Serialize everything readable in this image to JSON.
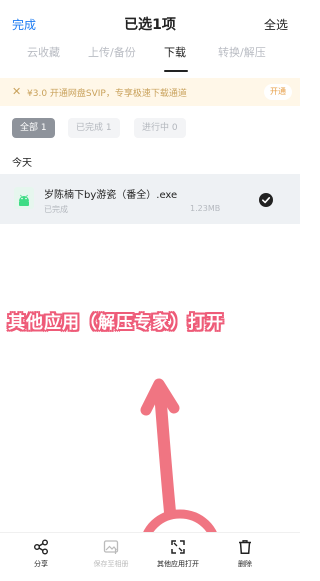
{
  "header": {
    "done_label": "完成",
    "title": "已选1项",
    "select_all_label": "全选"
  },
  "tabs": [
    {
      "label": "云收藏",
      "active": false
    },
    {
      "label": "上传/备份",
      "active": false
    },
    {
      "label": "下载",
      "active": true
    },
    {
      "label": "转换/解压",
      "active": false
    }
  ],
  "banner": {
    "text": "¥3.0 开通网盘SVIP，专享极速下载通道",
    "button_label": "开通"
  },
  "filters": [
    {
      "label": "全部 1",
      "active": true
    },
    {
      "label": "已完成 1",
      "active": false
    },
    {
      "label": "进行中 0",
      "active": false
    }
  ],
  "section_title": "今天",
  "file": {
    "name": "岁陈楠下by游瓷（番全）.exe",
    "status": "已完成",
    "size": "1.23MB",
    "selected": true
  },
  "annotation": {
    "text": "其他应用（解压专家）打开",
    "color": "#ee5b78"
  },
  "toolbar": [
    {
      "label": "分享",
      "icon": "share-icon",
      "enabled": true
    },
    {
      "label": "保存至相册",
      "icon": "save-album-icon",
      "enabled": false
    },
    {
      "label": "其他应用打开",
      "icon": "open-with-icon",
      "enabled": true
    },
    {
      "label": "删除",
      "icon": "trash-icon",
      "enabled": true
    }
  ],
  "colors": {
    "accent": "#1e7cf2",
    "banner_bg": "#fff7e8",
    "banner_text": "#c9a25c",
    "selected_row_bg": "#eef1f4",
    "android_green": "#3ddc84"
  }
}
